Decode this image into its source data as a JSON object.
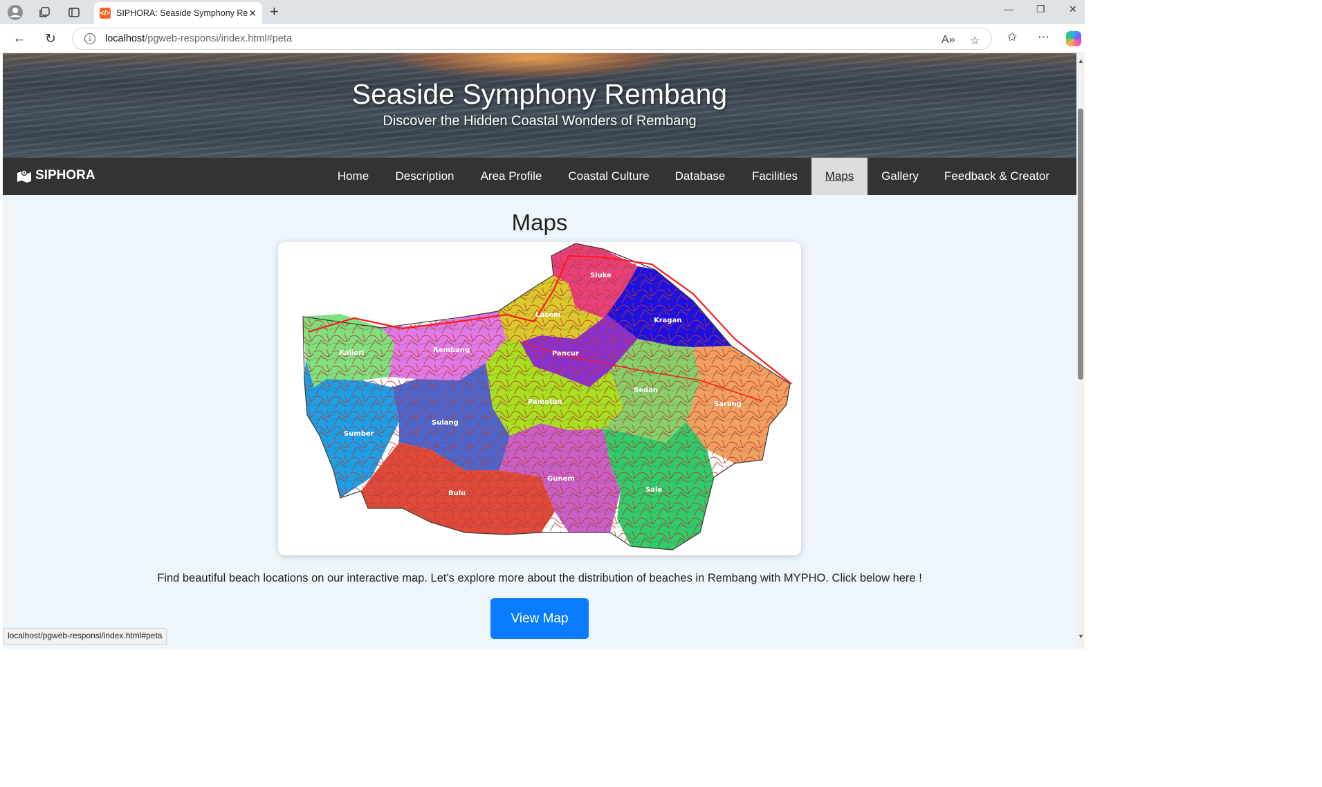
{
  "browser": {
    "tab_title": "SIPHORA: Seaside Symphony Rembang",
    "tab_favicon": "code-icon",
    "url_host": "localhost",
    "url_path": "/pgweb-responsi/index.html#peta",
    "status_url": "localhost/pgweb-responsi/index.html#peta"
  },
  "hero": {
    "title": "Seaside Symphony Rembang",
    "subtitle": "Discover the Hidden Coastal Wonders of Rembang"
  },
  "navbar": {
    "brand": "SIPHORA",
    "items": [
      {
        "label": "Home"
      },
      {
        "label": "Description"
      },
      {
        "label": "Area Profile"
      },
      {
        "label": "Coastal Culture"
      },
      {
        "label": "Database"
      },
      {
        "label": "Facilities"
      },
      {
        "label": "Maps",
        "active": true
      },
      {
        "label": "Gallery"
      },
      {
        "label": "Feedback & Creator"
      }
    ]
  },
  "maps_section": {
    "title": "Maps",
    "description": "Find beautiful beach locations on our interactive map. Let's explore more about the distribution of beaches in Rembang with MYPHO. Click below here !",
    "button_label": "View Map",
    "districts": [
      {
        "name": "Sluke",
        "color": "#e8407a"
      },
      {
        "name": "Lasem",
        "color": "#d9c92b"
      },
      {
        "name": "Kragan",
        "color": "#1d10e0"
      },
      {
        "name": "Kaliori",
        "color": "#7fe07d"
      },
      {
        "name": "Rembang",
        "color": "#e07ae8"
      },
      {
        "name": "Pancur",
        "color": "#8a30d0"
      },
      {
        "name": "Pamotan",
        "color": "#a6e020"
      },
      {
        "name": "Sedan",
        "color": "#86d06a"
      },
      {
        "name": "Sarang",
        "color": "#f0a060"
      },
      {
        "name": "Sumber",
        "color": "#1aa0e8"
      },
      {
        "name": "Sulang",
        "color": "#4a66d0"
      },
      {
        "name": "Gunem",
        "color": "#c860c8"
      },
      {
        "name": "Sale",
        "color": "#2ecc6a"
      },
      {
        "name": "Bulu",
        "color": "#e04a3a"
      }
    ]
  }
}
